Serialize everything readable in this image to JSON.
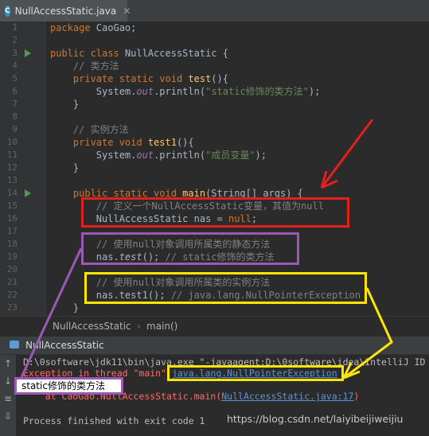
{
  "tab": {
    "title": "NullAccessStatic.java"
  },
  "editor": {
    "lines": [
      {
        "num": "1"
      },
      {
        "num": "2"
      },
      {
        "num": "3"
      },
      {
        "num": "4"
      },
      {
        "num": "5"
      },
      {
        "num": "6"
      },
      {
        "num": "7"
      },
      {
        "num": "8"
      },
      {
        "num": "9"
      },
      {
        "num": "10"
      },
      {
        "num": "11"
      },
      {
        "num": "12"
      },
      {
        "num": "13"
      },
      {
        "num": "14"
      },
      {
        "num": "15"
      },
      {
        "num": "16"
      },
      {
        "num": "17"
      },
      {
        "num": "18"
      },
      {
        "num": "19"
      },
      {
        "num": "20"
      },
      {
        "num": "21"
      },
      {
        "num": "22"
      },
      {
        "num": "23"
      }
    ],
    "code": {
      "l1_kw": "package",
      "l1_rest": " CaoGao;",
      "l3_kw": "public class",
      "l3_rest": " NullAccessStatic {",
      "l4": "    // 类方法",
      "l5_kw": "    private static void",
      "l5_fn": " test",
      "l5_rest": "(){",
      "l6_a": "        System.",
      "l6_fld": "out",
      "l6_b": ".println(",
      "l6_str": "\"static修饰的类方法\"",
      "l6_c": ");",
      "l7": "    }",
      "l9": "    // 实例方法",
      "l10_kw": "    private void",
      "l10_fn": " test1",
      "l10_rest": "(){",
      "l11_a": "        System.",
      "l11_fld": "out",
      "l11_b": ".println(",
      "l11_str": "\"成员变量\"",
      "l11_c": ");",
      "l12": "    }",
      "l14_kw": "    public static void",
      "l14_fn": " main",
      "l14_rest": "(String[] args) {",
      "l15": "        // 定义一个NullAccessStatic变量，其值为null",
      "l16_a": "        NullAccessStatic nas = ",
      "l16_kw": "null",
      "l16_b": ";",
      "l18": "        // 使用null对象调用所属类的静态方法",
      "l19_a": "        nas.",
      "l19_it": "test",
      "l19_b": "(); ",
      "l19_cm": "// static修饰的类方法",
      "l21": "        // 使用null对象调用所属类的实例方法",
      "l22_a": "        nas.test1(); ",
      "l22_cm": "// java.lang.NullPointerException",
      "l23": "    }"
    }
  },
  "breadcrumb": {
    "class": "NullAccessStatic",
    "sep": "›",
    "method": "main()"
  },
  "run": {
    "tab": "NullAccessStatic",
    "console": {
      "cmd": "D:\\0software\\jdk11\\bin\\java.exe \"-javaagent:D:\\0software\\idea\\IntelliJ ID",
      "exc_prefix": "Exception in thread \"main\" ",
      "exc_name": "java.lang.NullPointerException",
      "output": "static修饰的类方法",
      "at_prefix": "    at CaoGao.NullAccessStatic.main(",
      "at_link": "NullAccessStatic.java:17",
      "at_suffix": ")",
      "finish": "Process finished with exit code 1"
    }
  },
  "watermark": "https://blog.csdn.net/laiyibeijiweijiu",
  "colors": {
    "red": "#e2211c",
    "purple": "#9b59b6",
    "yellow": "#ffe600"
  }
}
